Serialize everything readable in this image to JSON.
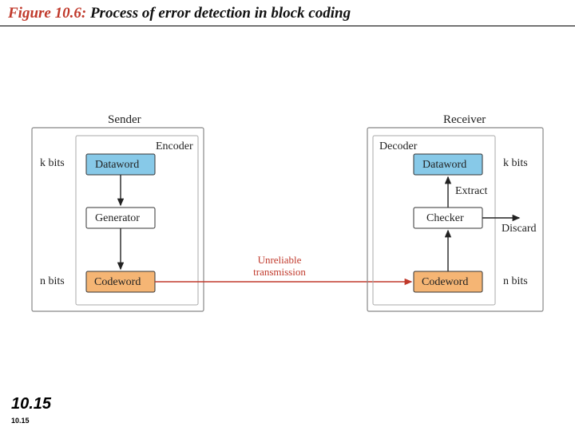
{
  "figure": {
    "number": "Figure 10.6:",
    "title": " Process of error detection in block coding"
  },
  "sender": {
    "title": "Sender",
    "encoder": "Encoder",
    "kbits": "k bits",
    "dataword": "Dataword",
    "generator": "Generator",
    "nbits": "n bits",
    "codeword": "Codeword"
  },
  "receiver": {
    "title": "Receiver",
    "decoder": "Decoder",
    "dataword": "Dataword",
    "kbits": "k bits",
    "extract": "Extract",
    "checker": "Checker",
    "discard": "Discard",
    "codeword": "Codeword",
    "nbits": "n bits"
  },
  "link": {
    "line1": "Unreliable",
    "line2": "transmission"
  },
  "page": {
    "big": "10.15",
    "small": "10.15"
  }
}
